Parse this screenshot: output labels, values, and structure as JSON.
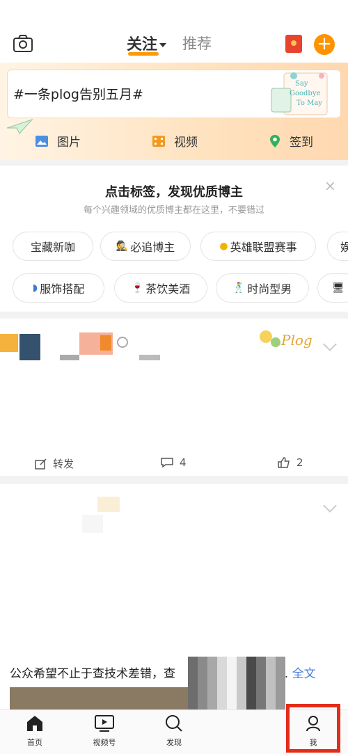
{
  "header": {
    "tabs": [
      {
        "label": "关注",
        "active": true
      },
      {
        "label": "推荐",
        "active": false
      }
    ],
    "icons": [
      "camera-icon",
      "red-envelope-icon",
      "plus-icon"
    ],
    "plus_label": "+"
  },
  "composer": {
    "topic_text": "#一条plog告别五月#",
    "sticker_text": [
      "Say",
      "Goodbye",
      "To May"
    ],
    "actions": [
      {
        "label": "图片",
        "icon": "image-icon"
      },
      {
        "label": "视频",
        "icon": "video-icon"
      },
      {
        "label": "签到",
        "icon": "location-pin-icon"
      }
    ]
  },
  "recommend": {
    "title": "点击标签，发现优质博主",
    "subtitle": "每个兴趣领域的优质博主都在这里，不要错过",
    "close": "×",
    "row1": [
      "宝藏新咖",
      "必追博主",
      "英雄联盟赛事",
      "娱"
    ],
    "row2": [
      "服饰搭配",
      "茶饮美酒",
      "时尚型男",
      ""
    ]
  },
  "post1": {
    "sticker": "Plog",
    "repost_label": "转发",
    "comment_count": "4",
    "like_count": "2"
  },
  "post2": {
    "text": "公众希望不止于查技术差错，查",
    "more_dots": "...",
    "fulltext_label": "全文"
  },
  "tabbar": [
    {
      "label": "首页",
      "icon": "home-icon"
    },
    {
      "label": "视频号",
      "icon": "video-channel-icon"
    },
    {
      "label": "发现",
      "icon": "search-icon"
    },
    {
      "label": "我",
      "icon": "profile-icon"
    }
  ],
  "colors": {
    "accent": "#ff9200",
    "highlight": "#e52b1a",
    "link": "#4a7fd8"
  }
}
